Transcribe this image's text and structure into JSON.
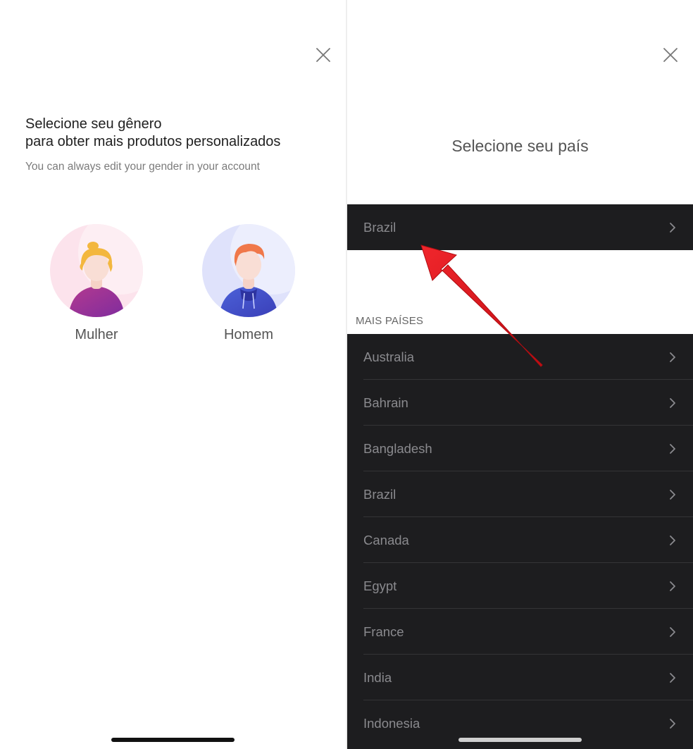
{
  "gender_screen": {
    "title_line1": "Selecione seu gênero",
    "title_line2": "para obter mais produtos personalizados",
    "subtitle": "You can always edit your gender in your account",
    "options": [
      {
        "label": "Mulher",
        "icon": "female-avatar-icon"
      },
      {
        "label": "Homem",
        "icon": "male-avatar-icon"
      }
    ],
    "close_icon": "close-icon"
  },
  "country_screen": {
    "title": "Selecione seu país",
    "selected_country": "Brazil",
    "section_label": "MAIS PAÍSES",
    "countries": [
      "Australia",
      "Bahrain",
      "Bangladesh",
      "Brazil",
      "Canada",
      "Egypt",
      "France",
      "India",
      "Indonesia"
    ],
    "close_icon": "close-icon",
    "chevron_icon": "chevron-right-icon"
  },
  "annotation": {
    "arrow_icon": "red-arrow-icon",
    "arrow_color": "#e8141b"
  },
  "colors": {
    "list_background": "#1d1d1f",
    "list_text": "#8a8a8e"
  }
}
